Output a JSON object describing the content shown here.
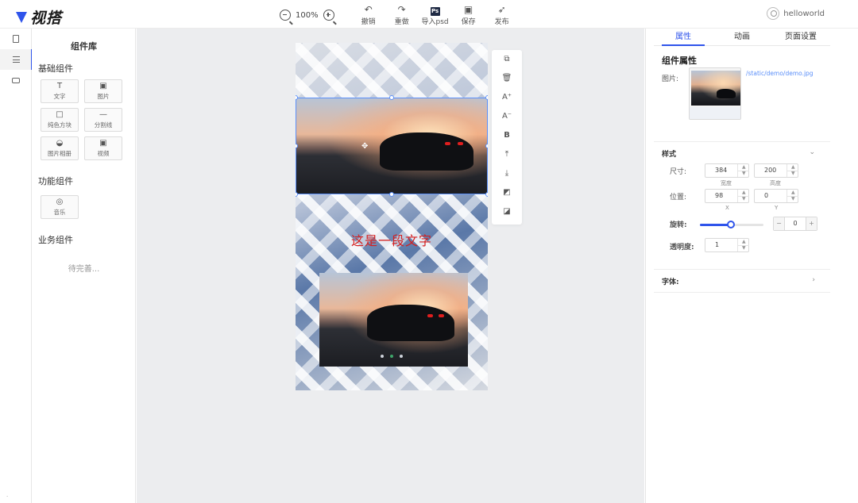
{
  "app": {
    "name": "视搭"
  },
  "toolbar": {
    "zoom_value": "100%",
    "undo_label": "撤销",
    "redo_label": "重做",
    "import_label": "导入psd",
    "import_icon_text": "Ps",
    "save_label": "保存",
    "publish_label": "发布"
  },
  "user": {
    "name": "helloworld"
  },
  "library": {
    "title": "组件库",
    "basic_section": "基础组件",
    "basic_items": [
      {
        "label": "文字",
        "icon": "T"
      },
      {
        "label": "图片",
        "icon": "▣"
      },
      {
        "label": "纯色方块",
        "icon": "□"
      },
      {
        "label": "分割线",
        "icon": "—"
      },
      {
        "label": "图片相册",
        "icon": "◒"
      },
      {
        "label": "视频",
        "icon": "▣"
      }
    ],
    "function_section": "功能组件",
    "function_items": [
      {
        "label": "音乐",
        "icon": "◎"
      }
    ],
    "business_section": "业务组件",
    "business_pending": "待完善..."
  },
  "canvas": {
    "text_element": "这是一段文字",
    "slide_count": 3,
    "active_slide": 2
  },
  "panel": {
    "tabs": [
      "属性",
      "动画",
      "页面设置"
    ],
    "active_tab": 0,
    "component_title": "组件属性",
    "image_label": "图片:",
    "image_url": "/static/demo/demo.jpg",
    "style_section": "样式",
    "size_label": "尺寸:",
    "width_value": "384",
    "width_sub": "宽度",
    "height_value": "200",
    "height_sub": "高度",
    "position_label": "位置:",
    "x_value": "98",
    "x_sub": "X",
    "y_value": "0",
    "y_sub": "Y",
    "rotation_label": "旋转:",
    "rotation_value": "0",
    "rotation_fraction": 0.5,
    "opacity_label": "透明度:",
    "opacity_value": "1",
    "font_section": "字体:"
  },
  "colors": {
    "accent": "#2f54eb",
    "text_red": "#d42020",
    "canvas_bg": "#ecedef"
  }
}
